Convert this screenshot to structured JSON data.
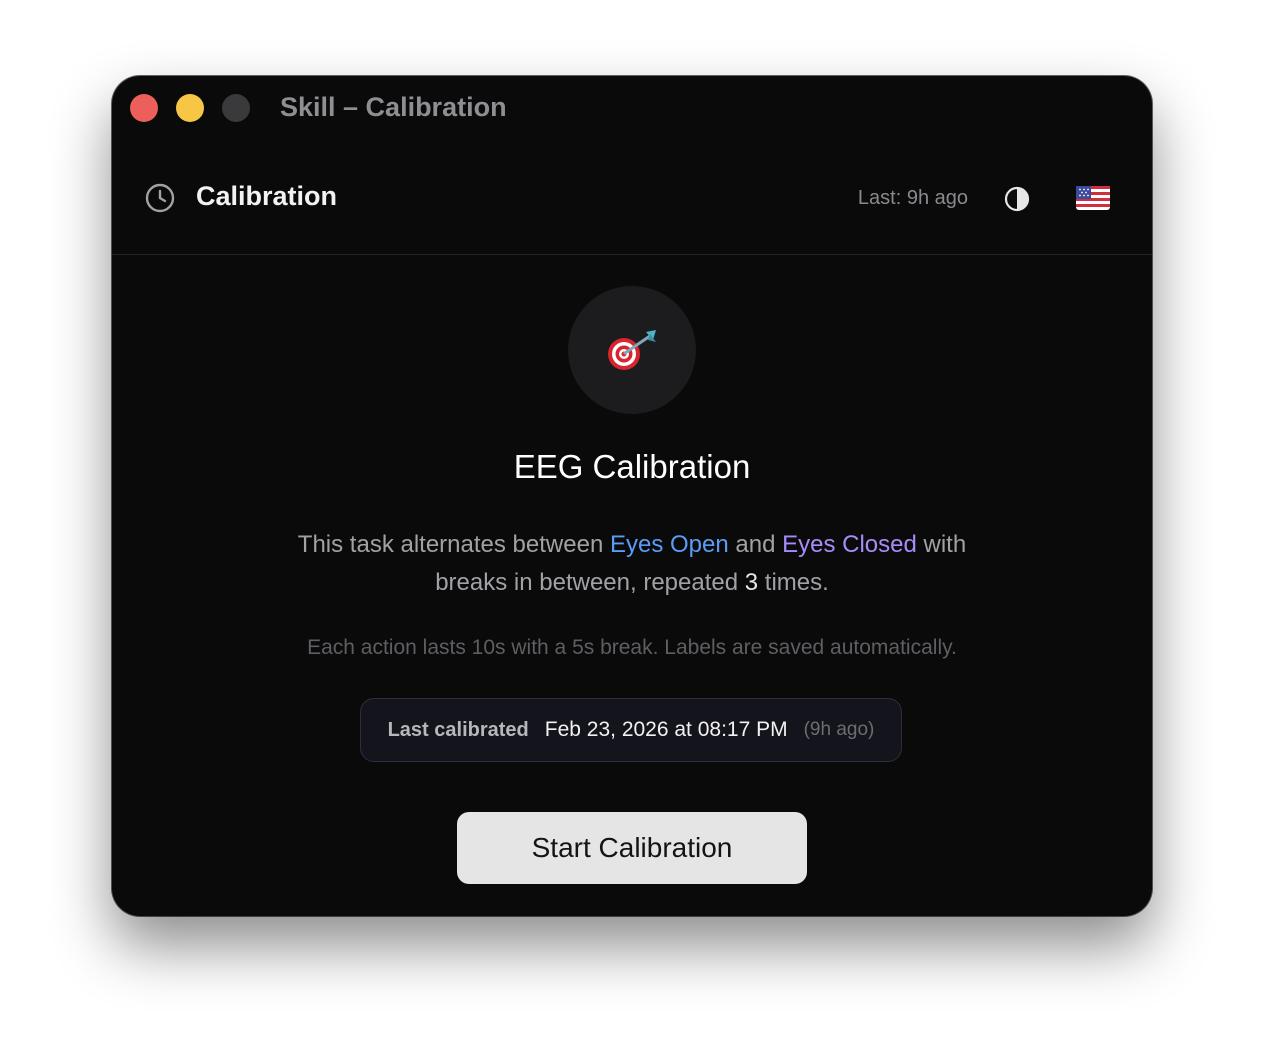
{
  "window": {
    "title": "Skill – Calibration"
  },
  "header": {
    "title": "Calibration",
    "last": "Last: 9h ago",
    "icons": [
      "history-icon",
      "contrast-icon",
      "us-flag-icon"
    ]
  },
  "main": {
    "title": "EEG Calibration",
    "desc_1": "This task alternates between",
    "eyes_open": "Eyes Open",
    "desc_and": "and",
    "eyes_closed": "Eyes Closed",
    "desc_2": "with breaks in between, repeated",
    "repeat_count": "3",
    "desc_3": "times.",
    "sub": "Each action lasts 10s with a 5s break. Labels are saved automatically.",
    "last_calibrated": {
      "label": "Last calibrated",
      "date": "Feb 23, 2026 at 08:17 PM",
      "ago": "(9h ago)"
    },
    "start_button": "Start Calibration"
  },
  "colors": {
    "eyes_open": "#5b9cf6",
    "eyes_closed": "#a78bfa",
    "close": "#ec5f5a",
    "minimize": "#f6c644"
  }
}
